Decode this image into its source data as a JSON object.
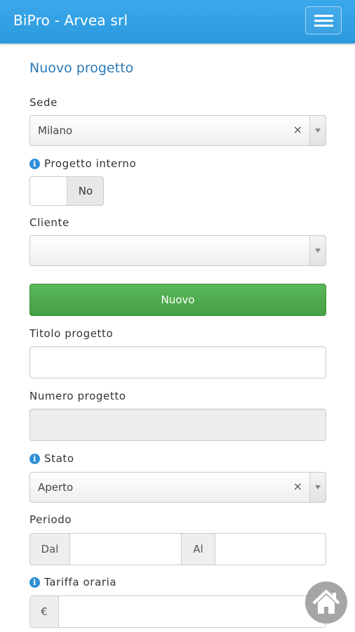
{
  "app": {
    "title": "BiPro - Arvea srl"
  },
  "page": {
    "title": "Nuovo progetto"
  },
  "form": {
    "sede": {
      "label": "Sede",
      "value": "Milano",
      "clear": "×"
    },
    "progetto_interno": {
      "label": "Progetto interno",
      "value": "No"
    },
    "cliente": {
      "label": "Cliente",
      "value": ""
    },
    "nuovo_button": "Nuovo",
    "titolo": {
      "label": "Titolo progetto",
      "value": ""
    },
    "numero": {
      "label": "Numero progetto",
      "value": ""
    },
    "stato": {
      "label": "Stato",
      "value": "Aperto",
      "clear": "×"
    },
    "periodo": {
      "label": "Periodo",
      "dal_label": "Dal",
      "al_label": "Al"
    },
    "tariffa": {
      "label": "Tariffa oraria",
      "currency": "€"
    }
  },
  "icons": {
    "info": "info-icon",
    "menu": "hamburger-icon",
    "home": "home-icon"
  },
  "colors": {
    "navbar": "#2c99de",
    "title": "#2a7ab8",
    "button": "#4cac4b",
    "info": "#2e8fd6"
  }
}
